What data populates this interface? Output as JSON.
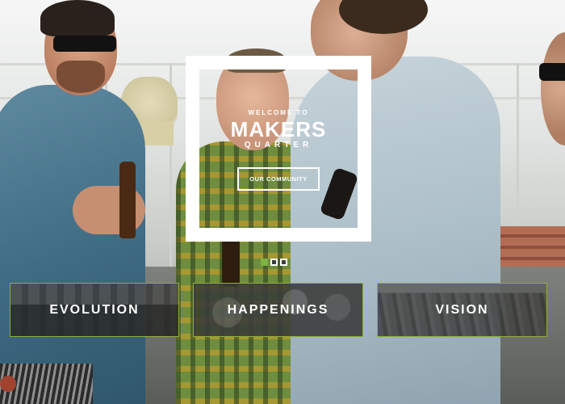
{
  "hero": {
    "welcome_eyebrow": "WELCOME TO",
    "title": "MAKERS",
    "subtitle": "QUARTER",
    "cta_label": "OUR COMMUNITY"
  },
  "slider": {
    "active_index": 0,
    "dots": [
      {
        "state": "active"
      },
      {
        "state": "inactive"
      },
      {
        "state": "inactive"
      }
    ]
  },
  "sections": [
    {
      "label": "EVOLUTION"
    },
    {
      "label": "HAPPENINGS"
    },
    {
      "label": "VISION"
    }
  ],
  "colors": {
    "accent": "#7cb342",
    "tile_border": "#8fae3a",
    "frame": "#ffffff"
  }
}
